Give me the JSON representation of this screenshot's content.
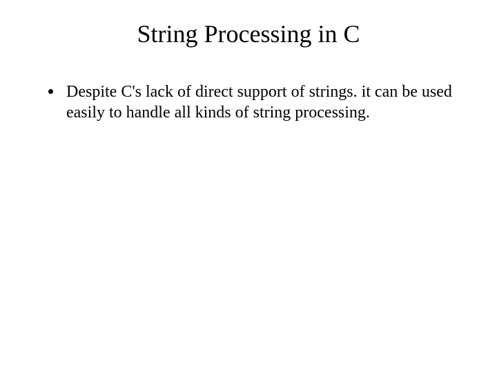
{
  "slide": {
    "title": "String Processing in C",
    "bullets": [
      "Despite C's lack of direct support of strings. it can be used easily to handle all kinds of string processing."
    ]
  }
}
